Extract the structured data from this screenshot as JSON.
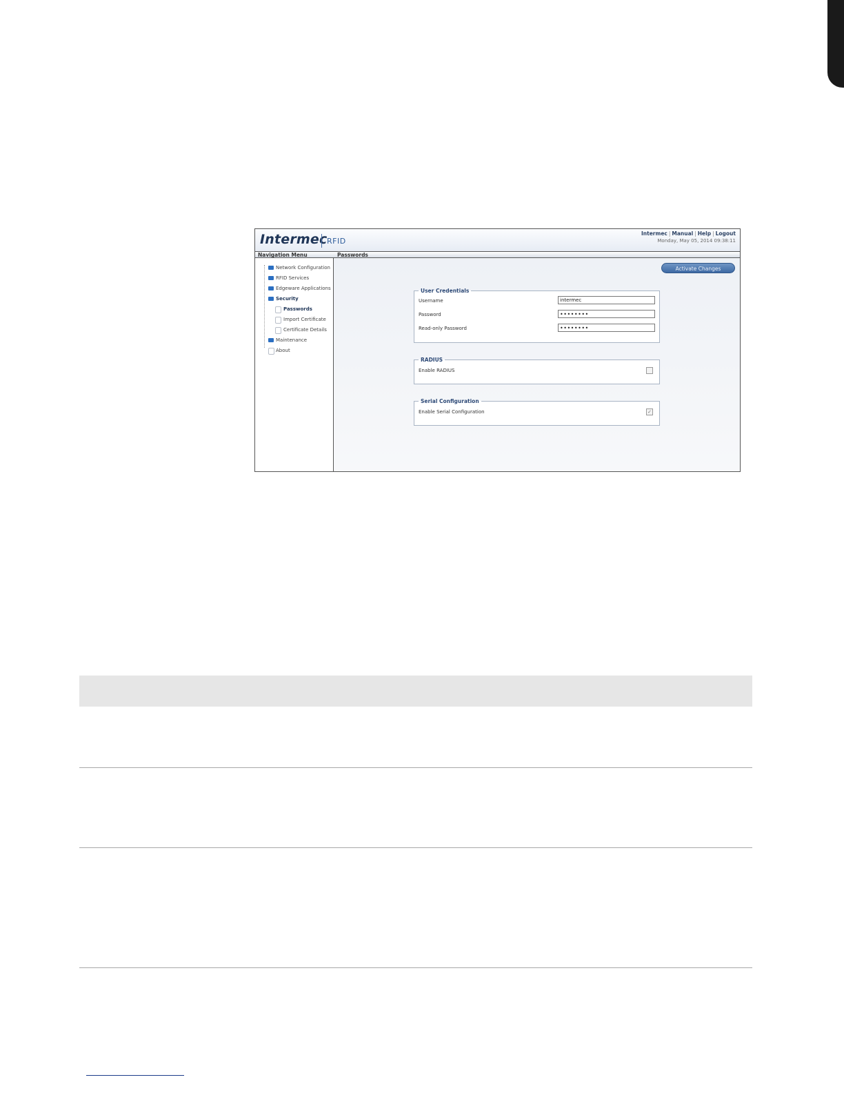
{
  "app": {
    "logo_text": "Intermec",
    "product": "RFID",
    "top_links": [
      "Intermec",
      "Manual",
      "Help",
      "Logout"
    ],
    "datetime": "Monday, May 05, 2014 09:38:11"
  },
  "nav": {
    "title": "Navigation Menu",
    "items": [
      {
        "label": "Network Configuration",
        "type": "folder"
      },
      {
        "label": "RFID Services",
        "type": "folder"
      },
      {
        "label": "Edgeware Applications",
        "type": "folder"
      },
      {
        "label": "Security",
        "type": "folder"
      },
      {
        "label": "Passwords",
        "type": "page"
      },
      {
        "label": "Import Certificate",
        "type": "page"
      },
      {
        "label": "Certificate Details",
        "type": "page"
      },
      {
        "label": "Maintenance",
        "type": "folder"
      },
      {
        "label": "About",
        "type": "page"
      }
    ]
  },
  "page": {
    "title": "Passwords",
    "activate_label": "Activate Changes"
  },
  "user_credentials": {
    "legend": "User Credentials",
    "username_label": "Username",
    "username_value": "intermec",
    "password_label": "Password",
    "password_value": "••••••••",
    "readonly_label": "Read-only Password",
    "readonly_value": "••••••••"
  },
  "radius": {
    "legend": "RADIUS",
    "enable_label": "Enable RADIUS",
    "enabled": false
  },
  "serial": {
    "legend": "Serial Configuration",
    "enable_label": "Enable Serial Configuration",
    "enabled": true,
    "check_glyph": "✓"
  }
}
